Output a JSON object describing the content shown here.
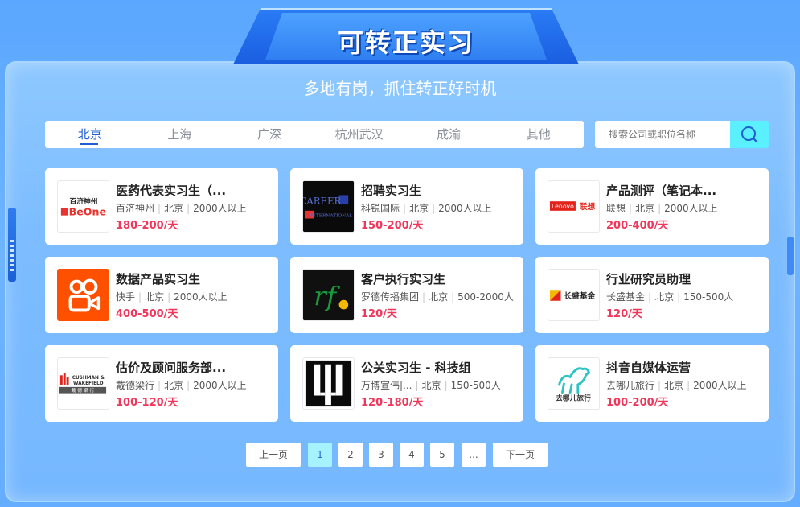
{
  "header": {
    "title": "可转正实习",
    "subtitle": "多地有岗，抓住转正好时机"
  },
  "tabs": [
    {
      "label": "北京",
      "active": true
    },
    {
      "label": "上海",
      "active": false
    },
    {
      "label": "广深",
      "active": false
    },
    {
      "label": "杭州武汉",
      "active": false
    },
    {
      "label": "成渝",
      "active": false
    },
    {
      "label": "其他",
      "active": false
    }
  ],
  "search": {
    "placeholder": "搜索公司或职位名称",
    "icon": "search-icon",
    "button_color": "#5af0ff"
  },
  "jobs": [
    {
      "title": "医药代表实习生（...",
      "company": "百济神州",
      "city": "北京",
      "size": "2000人以上",
      "salary": "180-200/天",
      "logo_text": "百济神州",
      "logo_text2": "BeOne"
    },
    {
      "title": "招聘实习生",
      "company": "科锐国际",
      "city": "北京",
      "size": "2000人以上",
      "salary": "150-200/天",
      "logo_text": "CAREER",
      "logo_text2": "INTERNATIONAL"
    },
    {
      "title": "产品测评（笔记本...",
      "company": "联想",
      "city": "北京",
      "size": "2000人以上",
      "salary": "200-400/天",
      "logo_text": "Lenovo",
      "logo_text2": "联想"
    },
    {
      "title": "数据产品实习生",
      "company": "快手",
      "city": "北京",
      "size": "2000人以上",
      "salary": "400-500/天"
    },
    {
      "title": "客户执行实习生",
      "company": "罗德传播集团",
      "city": "北京",
      "size": "500-2000人",
      "salary": "120/天",
      "logo_text": "rf"
    },
    {
      "title": "行业研究员助理",
      "company": "长盛基金",
      "city": "北京",
      "size": "150-500人",
      "salary": "120/天",
      "logo_text": "长盛基金"
    },
    {
      "title": "估价及顾问服务部...",
      "company": "戴德梁行",
      "city": "北京",
      "size": "2000人以上",
      "salary": "100-120/天",
      "logo_text": "CUSHMAN &",
      "logo_text2": "WAKEFIELD",
      "logo_text3": "戴 德 梁 行"
    },
    {
      "title": "公关实习生 - 科技组",
      "company": "万博宣伟|...",
      "city": "北京",
      "size": "150-500人",
      "salary": "120-180/天"
    },
    {
      "title": "抖音自媒体运营",
      "company": "去哪儿旅行",
      "city": "北京",
      "size": "2000人以上",
      "salary": "100-200/天",
      "logo_text": "去哪儿旅行"
    }
  ],
  "pagination": {
    "prev": "上一页",
    "pages": [
      "1",
      "2",
      "3",
      "4",
      "5",
      "..."
    ],
    "current": "1",
    "next": "下一页"
  },
  "colors": {
    "accent": "#1f5fd2",
    "salary": "#f0365a",
    "active_page": "#a6f3ff"
  }
}
